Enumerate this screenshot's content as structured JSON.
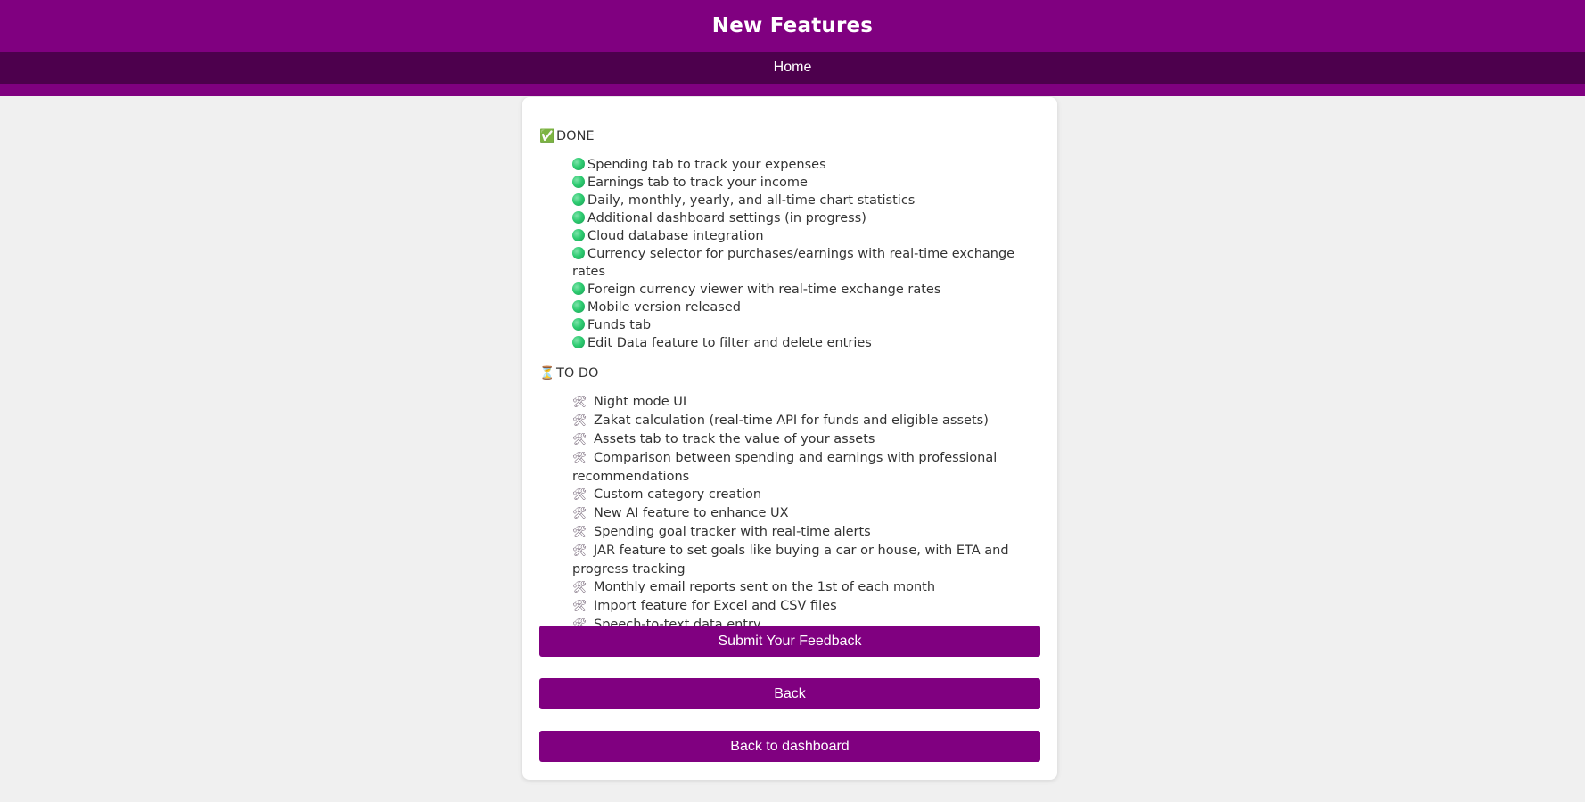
{
  "header": {
    "title": "New Features"
  },
  "nav": {
    "home_label": "Home"
  },
  "done": {
    "icon": "✅",
    "title": "DONE",
    "items": [
      "Spending tab to track your expenses",
      "Earnings tab to track your income",
      "Daily, monthly, yearly, and all-time chart statistics",
      "Additional dashboard settings (in progress)",
      "Cloud database integration",
      "Currency selector for purchases/earnings with real-time exchange rates",
      "Foreign currency viewer with real-time exchange rates",
      "Mobile version released",
      "Funds tab",
      "Edit Data feature to filter and delete entries"
    ]
  },
  "todo": {
    "icon": "⏳",
    "item_icon": "🛠",
    "title": "TO DO",
    "items": [
      "Night mode UI",
      "Zakat calculation (real-time API for funds and eligible assets)",
      "Assets tab to track the value of your assets",
      "Comparison between spending and earnings with professional recommendations",
      "Custom category creation",
      "New AI feature to enhance UX",
      "Spending goal tracker with real-time alerts",
      "JAR feature to set goals like buying a car or house, with ETA and progress tracking",
      "Monthly email reports sent on the 1st of each month",
      "Import feature for Excel and CSV files",
      "Speech-to-text data entry"
    ]
  },
  "buttons": {
    "feedback": "Submit Your Feedback",
    "back": "Back",
    "dashboard": "Back to dashboard"
  },
  "colors": {
    "primary": "#800080",
    "nav": "#4d004d",
    "page_background": "#f0f0f0",
    "card": "#ffffff"
  },
  "icons": {
    "done_section": "check-box-icon",
    "done_item": "green-circle-icon",
    "todo_section": "hourglass-icon",
    "todo_item": "tools-icon"
  }
}
